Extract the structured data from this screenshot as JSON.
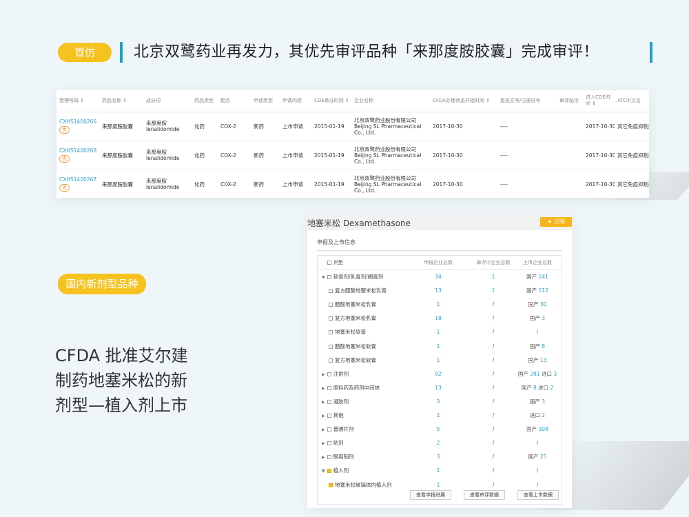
{
  "top_tag": "首仿",
  "headline": "北京双鹭药业再发力，其优先审评品种「来那度胺胶囊」完成审评！",
  "registry": {
    "headers": [
      "受理号码 ⇕",
      "药品名称 ⇕",
      "成分词",
      "药品类型",
      "靶点",
      "申请类型",
      "申请内容",
      "CDE承办时间 ⇕",
      "企业名称",
      "CFDA办理状态开始时间 ⇕",
      "批准文号/注册证号",
      "审评结论",
      "进入CDE时间 ⇕",
      "ATC中文名"
    ],
    "rows": [
      {
        "code": "CXHS1400266",
        "badge": "优",
        "name": "来那度胺胶囊",
        "ingredient": "来那度胺 lenalidomide",
        "type": "化药",
        "target": "COX-2",
        "apply": "新药",
        "content": "上市申请",
        "cde_date": "2015-01-19",
        "company": "北京双鹭药业股份有限公司 Beijing SL Pharmaceutical Co., Ltd.",
        "cfda_date": "2017-10-30",
        "approval": "----",
        "conclusion": "",
        "enter_date": "2017-10-30",
        "atc": "其它免疫抑制剂"
      },
      {
        "code": "CXHS1400268",
        "badge": "优",
        "name": "来那度胺胶囊",
        "ingredient": "来那度胺 lenalidomide",
        "type": "化药",
        "target": "COX-2",
        "apply": "新药",
        "content": "上市申请",
        "cde_date": "2015-01-19",
        "company": "北京双鹭药业股份有限公司 Beijing SL Pharmaceutical Co., Ltd.",
        "cfda_date": "2017-10-30",
        "approval": "----",
        "conclusion": "",
        "enter_date": "2017-10-30",
        "atc": "其它免疫抑制剂"
      },
      {
        "code": "CXHS1400267",
        "badge": "优",
        "name": "来那度胺胶囊",
        "ingredient": "来那度胺 lenalidomide",
        "type": "化药",
        "target": "COX-2",
        "apply": "新药",
        "content": "上市申请",
        "cde_date": "2015-01-19",
        "company": "北京双鹭药业股份有限公司 Beijing SL Pharmaceutical Co., Ltd.",
        "cfda_date": "2017-10-30",
        "approval": "----",
        "conclusion": "",
        "enter_date": "2017-10-30",
        "atc": "其它免疫抑制剂"
      }
    ]
  },
  "mid_tag": "国内新剂型品种",
  "side_text": [
    "CFDA 批准艾尔建",
    "制药地塞米松的新",
    "剂型—植入剂上市"
  ],
  "detail": {
    "title": "地塞米松 Dexamethasone",
    "subscribe": "★ 订阅",
    "section": "申报及上市信息",
    "columns": [
      "剂型",
      "申报企业总数",
      "审评中企业总数",
      "上市企业总数"
    ],
    "rows": [
      {
        "expand": "▼",
        "checked": false,
        "name": "软膏剂/乳膏剂/糊膏剂",
        "n1": "34",
        "n2": "1",
        "n3": "国产 141",
        "indent": false
      },
      {
        "expand": "",
        "checked": false,
        "name": "复方醋酸地塞米松乳膏",
        "n1": "13",
        "n2": "1",
        "n3": "国产 112",
        "indent": true
      },
      {
        "expand": "",
        "checked": false,
        "name": "醋酸地塞米松乳膏",
        "n1": "1",
        "n2": "/",
        "n3": "国产 30",
        "indent": true
      },
      {
        "expand": "",
        "checked": false,
        "name": "复方地塞米松乳膏",
        "n1": "18",
        "n2": "/",
        "n3": "国产 3",
        "indent": true
      },
      {
        "expand": "",
        "checked": false,
        "name": "地塞米松软膏",
        "n1": "1",
        "n2": "/",
        "n3": "/",
        "indent": true
      },
      {
        "expand": "",
        "checked": false,
        "name": "醋酸地塞米松软膏",
        "n1": "1",
        "n2": "/",
        "n3": "国产 8",
        "indent": true
      },
      {
        "expand": "",
        "checked": false,
        "name": "复方地塞米松软膏",
        "n1": "1",
        "n2": "/",
        "n3": "国产 13",
        "indent": true
      },
      {
        "expand": "▶",
        "checked": false,
        "name": "注射剂",
        "n1": "92",
        "n2": "/",
        "n3": "国产 281 进口 3",
        "indent": false
      },
      {
        "expand": "▶",
        "checked": false,
        "name": "原料药及药剂中间体",
        "n1": "13",
        "n2": "/",
        "n3": "国产 8 进口 2",
        "indent": false
      },
      {
        "expand": "▶",
        "checked": false,
        "name": "凝胶剂",
        "n1": "3",
        "n2": "/",
        "n3": "国产 3",
        "indent": false
      },
      {
        "expand": "▶",
        "checked": false,
        "name": "其他",
        "n1": "1",
        "n2": "/",
        "n3": "进口 2",
        "indent": false
      },
      {
        "expand": "▶",
        "checked": false,
        "name": "普通片剂",
        "n1": "5",
        "n2": "/",
        "n3": "国产 308",
        "indent": false
      },
      {
        "expand": "▶",
        "checked": false,
        "name": "贴剂",
        "n1": "2",
        "n2": "/",
        "n3": "/",
        "indent": false
      },
      {
        "expand": "▶",
        "checked": false,
        "name": "眼用制剂",
        "n1": "3",
        "n2": "/",
        "n3": "国产 25",
        "indent": false
      },
      {
        "expand": "▼",
        "checked": true,
        "name": "植入剂",
        "n1": "1",
        "n2": "/",
        "n3": "/",
        "indent": false
      },
      {
        "expand": "",
        "checked": true,
        "name": "地塞米松玻璃体内植入剂",
        "n1": "1",
        "n2": "/",
        "n3": "/",
        "indent": true
      }
    ],
    "buttons": [
      "查看申报进展",
      "查看审评数据",
      "查看上市数据"
    ]
  }
}
